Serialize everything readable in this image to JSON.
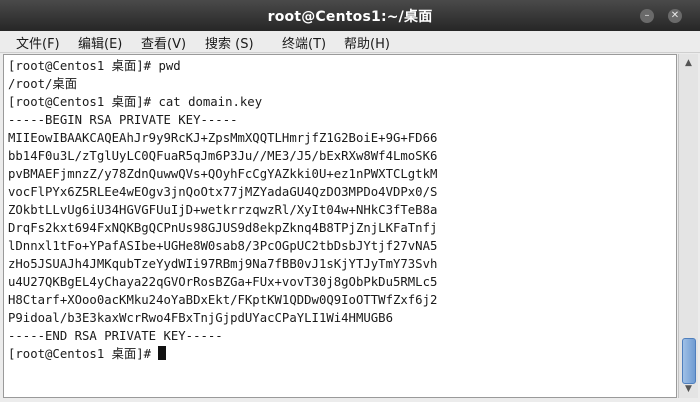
{
  "window": {
    "title": "root@Centos1:~/桌面",
    "minimize_icon": "minimize-icon",
    "close_icon": "close-icon"
  },
  "menu": [
    {
      "label": "文件(F)"
    },
    {
      "label": "编辑(E)"
    },
    {
      "label": "查看(V)"
    },
    {
      "label": "搜索 (S)"
    },
    {
      "label": "终端(T)"
    },
    {
      "label": "帮助(H)"
    }
  ],
  "terminal": {
    "lines": [
      "[root@Centos1 桌面]# pwd",
      "/root/桌面",
      "[root@Centos1 桌面]# cat domain.key",
      "-----BEGIN RSA PRIVATE KEY-----",
      "MIIEowIBAAKCAQEAhJr9y9RcKJ+ZpsMmXQQTLHmrjfZ1G2BoiE+9G+FD66",
      "bb14F0u3L/zTglUyLC0QFuaR5qJm6P3Ju//ME3/J5/bExRXw8Wf4LmoSK6",
      "pvBMAEFjmnzZ/y78ZdnQuwwQVs+QOyhFcCgYAZkki0U+ez1nPWXTCLgtkM",
      "vocFlPYx6Z5RLEe4wEOgv3jnQoOtx77jMZYadaGU4QzDO3MPDo4VDPx0/S",
      "ZOkbtLLvUg6iU34HGVGFUuIjD+wetkrrzqwzRl/XyIt04w+NHkC3fTeB8a",
      "DrqFs2kxt694FxNQKBgQCPnUs98GJUS9d8ekpZknq4B8TPjZnjLKFaTnfj",
      "lDnnxl1tFo+YPafASIbe+UGHe8W0sab8/3PcOGpUC2tbDsbJYtjf27vNA5",
      "zHo5JSUAJh4JMKqubTzeYydWIi97RBmj9Na7fBB0vJ1sKjYTJyTmY73Svh",
      "u4U27QKBgEL4yChaya22qGVOrRosBZGa+FUx+vovT30j8gObPkDu5RMLc5",
      "H8Ctarf+XOoo0acKMku24oYaBDxEkt/FKptKW1QDDw0Q9IoOTTWfZxf6j2",
      "P9idoal/b3E3kaxWcrRwo4FBxTnjGjpdUYacCPaYLI1Wi4HMUGB6",
      "-----END RSA PRIVATE KEY-----",
      "[root@Centos1 桌面]# "
    ]
  },
  "scrollbar": {
    "up_icon": "scroll-up-arrow-icon",
    "down_icon": "scroll-down-arrow-icon",
    "position": 0.95
  }
}
